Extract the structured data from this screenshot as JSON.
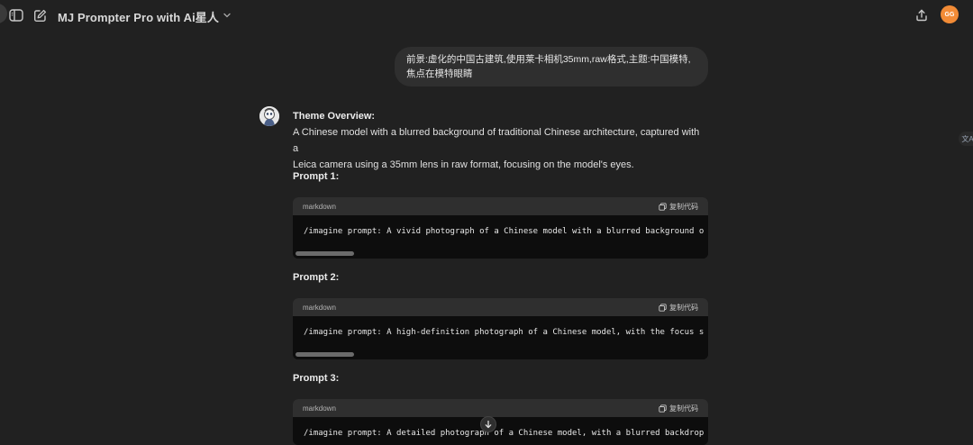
{
  "header": {
    "title": "MJ Prompter Pro with Ai星人",
    "user_initials": "GG",
    "icons": {
      "sidebar_toggle": "sidebar-toggle-icon",
      "new_chat": "new-chat-icon",
      "dropdown": "chevron-down-icon",
      "share": "share-icon"
    }
  },
  "user_message": {
    "line1": "前景:虚化的中国古建筑,使用莱卡相机35mm,raw格式,主题:中国模特,",
    "line2": "焦点在模特眼睛"
  },
  "assistant": {
    "overview_heading": "Theme Overview:",
    "overview_line1": "A Chinese model with a blurred background of traditional Chinese architecture, captured with a",
    "overview_line2": "Leica camera using a 35mm lens in raw format, focusing on the model's eyes.",
    "prompts": [
      {
        "label": "Prompt 1:",
        "language": "markdown",
        "copy_label": "复制代码",
        "code": "/imagine prompt: A vivid photograph of a Chinese model with a blurred background o"
      },
      {
        "label": "Prompt 2:",
        "language": "markdown",
        "copy_label": "复制代码",
        "code": "/imagine prompt: A high-definition photograph of a Chinese model, with the focus s"
      },
      {
        "label": "Prompt 3:",
        "language": "markdown",
        "copy_label": "复制代码",
        "code": "/imagine prompt: A detailed photograph of a Chinese model, with a blurred backdrop"
      }
    ]
  },
  "translate_tab": "文A",
  "colors": {
    "background": "#212121",
    "bubble": "#2f2f2f",
    "code_bg": "#0d0d0d",
    "avatar": "#f28b36"
  }
}
